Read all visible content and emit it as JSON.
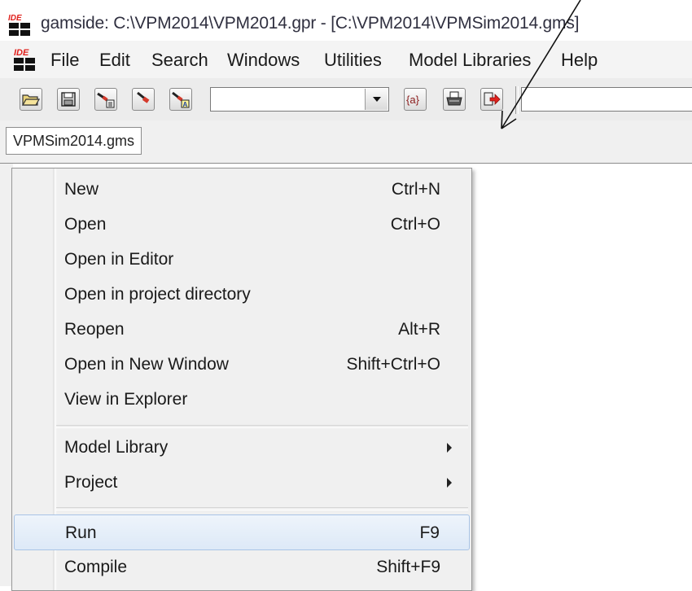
{
  "window": {
    "title": "gamside: C:\\VPM2014\\VPM2014.gpr - [C:\\VPM2014\\VPMSim2014.gms]",
    "logo_text": "IDE"
  },
  "menubar": {
    "items": [
      {
        "label": "File"
      },
      {
        "label": "Edit"
      },
      {
        "label": "Search"
      },
      {
        "label": "Windows"
      },
      {
        "label": "Utilities"
      },
      {
        "label": "Model Libraries"
      },
      {
        "label": "Help"
      }
    ]
  },
  "toolbar": {
    "buttons": [
      {
        "icon": "open-folder-icon"
      },
      {
        "icon": "save-icon"
      },
      {
        "icon": "find-in-files-icon"
      },
      {
        "icon": "find-icon"
      },
      {
        "icon": "find-replace-icon"
      },
      {
        "icon": "symbol-braces-icon",
        "text": "{a}"
      },
      {
        "icon": "print-icon"
      },
      {
        "icon": "run-exit-icon"
      }
    ],
    "combo_value": "",
    "right_field_value": ""
  },
  "tabs": [
    {
      "label": "VPMSim2014.gms",
      "active": true
    }
  ],
  "file_menu": {
    "items": [
      {
        "label": "New",
        "shortcut": "Ctrl+N"
      },
      {
        "label": "Open",
        "shortcut": "Ctrl+O"
      },
      {
        "label": "Open in Editor",
        "shortcut": ""
      },
      {
        "label": "Open in project directory",
        "shortcut": ""
      },
      {
        "label": "Reopen",
        "shortcut": "Alt+R"
      },
      {
        "label": "Open in New Window",
        "shortcut": "Shift+Ctrl+O"
      },
      {
        "label": "View in Explorer",
        "shortcut": ""
      },
      {
        "label": "Model Library",
        "shortcut": "",
        "submenu": true
      },
      {
        "label": "Project",
        "shortcut": "",
        "submenu": true
      },
      {
        "label": "Run",
        "shortcut": "F9",
        "highlighted": true
      },
      {
        "label": "Compile",
        "shortcut": "Shift+F9"
      }
    ]
  },
  "colors": {
    "logo_red": "#e0201c",
    "highlight_border": "#a9c4e6",
    "menu_background": "#f0f0f0"
  }
}
